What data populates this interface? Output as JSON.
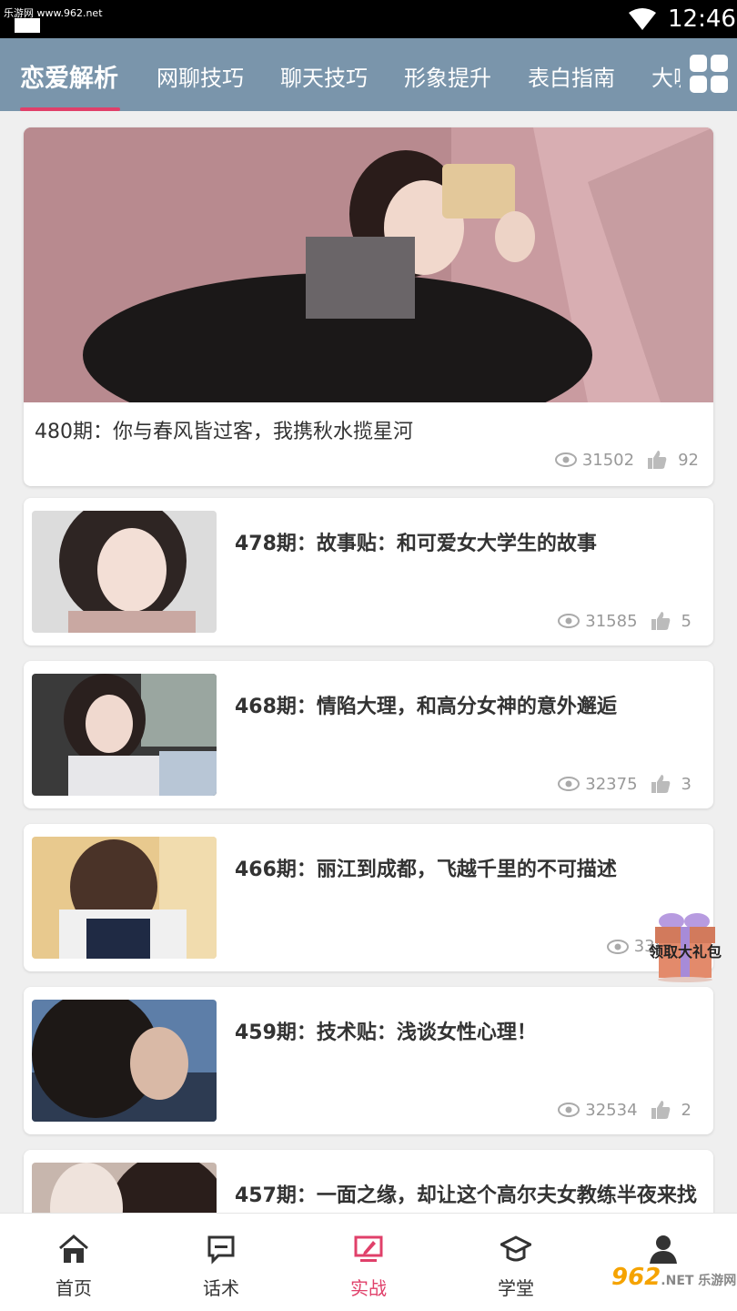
{
  "status_bar": {
    "watermark": "乐游网 www.962.net",
    "time": "12:46"
  },
  "tabs": [
    {
      "label": "恋爱解析",
      "active": true
    },
    {
      "label": "网聊技巧",
      "active": false
    },
    {
      "label": "聊天技巧",
      "active": false
    },
    {
      "label": "形象提升",
      "active": false
    },
    {
      "label": "表白指南",
      "active": false
    },
    {
      "label": "大咖",
      "active": false
    }
  ],
  "featured": {
    "title": "480期：你与春风皆过客，我携秋水揽星河",
    "views": "31502",
    "likes": "92"
  },
  "articles": [
    {
      "title": "478期：故事贴：和可爱女大学生的故事",
      "views": "31585",
      "likes": "5"
    },
    {
      "title": "468期：情陷大理，和高分女神的意外邂逅",
      "views": "32375",
      "likes": "3"
    },
    {
      "title": "466期：丽江到成都，飞越千里的不可描述",
      "views": "33822",
      "likes": ""
    },
    {
      "title": "459期：技术贴：浅谈女性心理！",
      "views": "32534",
      "likes": "2"
    },
    {
      "title": "457期：一面之缘，却让这个高尔夫女教练半夜来找我",
      "views": "",
      "likes": ""
    }
  ],
  "gift": {
    "label": "领取大礼包"
  },
  "bottom_nav": [
    {
      "label": "首页",
      "icon": "home-icon",
      "active": false
    },
    {
      "label": "话术",
      "icon": "chat-icon",
      "active": false
    },
    {
      "label": "实战",
      "icon": "practice-icon",
      "active": true
    },
    {
      "label": "学堂",
      "icon": "graduation-cap-icon",
      "active": false
    },
    {
      "label": "我的",
      "icon": "user-icon",
      "active": false
    }
  ],
  "colors": {
    "tabbar": "#7a95ab",
    "accent": "#e0406a",
    "background": "#efefef"
  },
  "logo": {
    "text": "962",
    "sub": ".NET 乐游网"
  }
}
